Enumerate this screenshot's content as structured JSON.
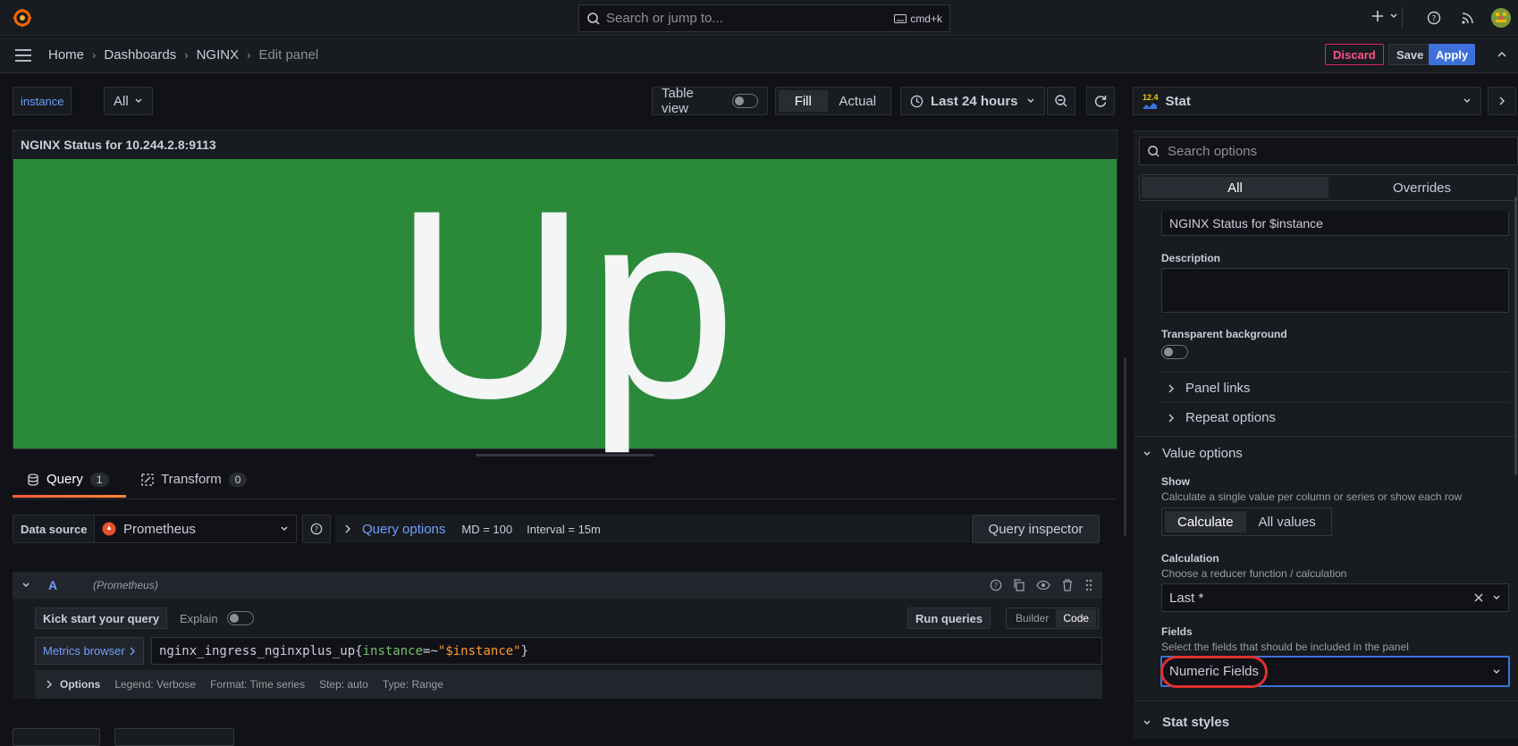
{
  "topbar": {
    "search_placeholder": "Search or jump to...",
    "shortcut": "cmd+k"
  },
  "breadcrumbs": [
    "Home",
    "Dashboards",
    "NGINX",
    "Edit panel"
  ],
  "actions": {
    "discard": "Discard",
    "save": "Save",
    "apply": "Apply"
  },
  "variables": {
    "name": "instance",
    "value": "All"
  },
  "toolbar": {
    "table_view": "Table view",
    "fill": "Fill",
    "actual": "Actual",
    "time_range": "Last 24 hours"
  },
  "panel": {
    "title": "NGINX Status for 10.244.2.8:9113",
    "stat_value": "Up",
    "stat_color": "#2a8a3a"
  },
  "tabs": [
    {
      "label": "Query",
      "count": "1"
    },
    {
      "label": "Transform",
      "count": "0"
    }
  ],
  "query_bar": {
    "datasource_label": "Data source",
    "datasource": "Prometheus",
    "query_options": "Query options",
    "md": "MD = 100",
    "interval": "Interval = 15m",
    "inspector": "Query inspector"
  },
  "query": {
    "ref": "A",
    "datasource": "(Prometheus)",
    "kick_start": "Kick start your query",
    "explain": "Explain",
    "run": "Run queries",
    "builder": "Builder",
    "code": "Code",
    "metrics_browser": "Metrics browser",
    "expr_metric": "nginx_ingress_nginxplus_up",
    "expr_label": "instance",
    "expr_op": "=~",
    "expr_value": "\"$instance\"",
    "options_label": "Options",
    "legend": "Legend: Verbose",
    "format": "Format: Time series",
    "step": "Step: auto",
    "type": "Type: Range"
  },
  "right_pane": {
    "viz_badge": "12.4",
    "viz_name": "Stat",
    "search_placeholder": "Search options",
    "tab_all": "All",
    "tab_overrides": "Overrides",
    "title_value": "NGINX Status for $instance",
    "description_label": "Description",
    "transparent_label": "Transparent background",
    "panel_links": "Panel links",
    "repeat_options": "Repeat options",
    "value_options": "Value options",
    "show_label": "Show",
    "show_desc": "Calculate a single value per column or series or show each row",
    "calculate": "Calculate",
    "all_values": "All values",
    "calc_label": "Calculation",
    "calc_desc": "Choose a reducer function / calculation",
    "calc_value": "Last *",
    "fields_label": "Fields",
    "fields_desc": "Select the fields that should be included in the panel",
    "fields_value": "Numeric Fields",
    "stat_styles": "Stat styles"
  },
  "colors": {
    "accent": "#3d71d9",
    "link": "#6e9fff",
    "danger": "#e0226e",
    "highlight": "#e02f2f"
  }
}
